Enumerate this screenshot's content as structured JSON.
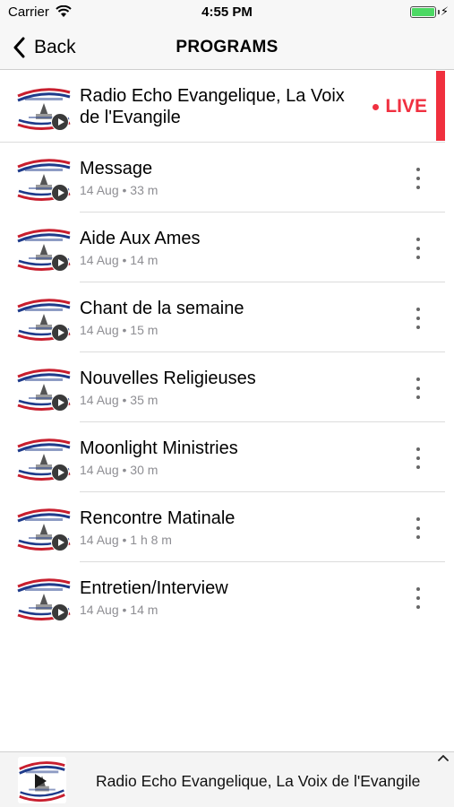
{
  "status_bar": {
    "carrier": "Carrier",
    "time": "4:55 PM"
  },
  "nav": {
    "back_label": "Back",
    "title": "PROGRAMS"
  },
  "live_item": {
    "title": "Radio Echo Evangelique, La Voix de l'Evangile",
    "badge": "LIVE",
    "accent_color": "#f0303e"
  },
  "programs": [
    {
      "title": "Message",
      "meta": "14 Aug • 33 m"
    },
    {
      "title": "Aide Aux Ames",
      "meta": "14 Aug • 14 m"
    },
    {
      "title": "Chant de la semaine",
      "meta": "14 Aug • 15 m"
    },
    {
      "title": "Nouvelles Religieuses",
      "meta": "14 Aug • 35 m"
    },
    {
      "title": "Moonlight Ministries",
      "meta": "14 Aug • 30 m"
    },
    {
      "title": "Rencontre Matinale",
      "meta": "14 Aug • 1 h 8 m"
    },
    {
      "title": "Entretien/Interview",
      "meta": "14 Aug • 14 m"
    }
  ],
  "mini_player": {
    "title": "Radio Echo Evangelique, La Voix de l'Evangile"
  },
  "icons": {
    "back": "chevron-left-icon",
    "more": "more-vertical-icon",
    "play": "play-icon",
    "expand": "chevron-up-icon",
    "logo": "station-logo"
  }
}
